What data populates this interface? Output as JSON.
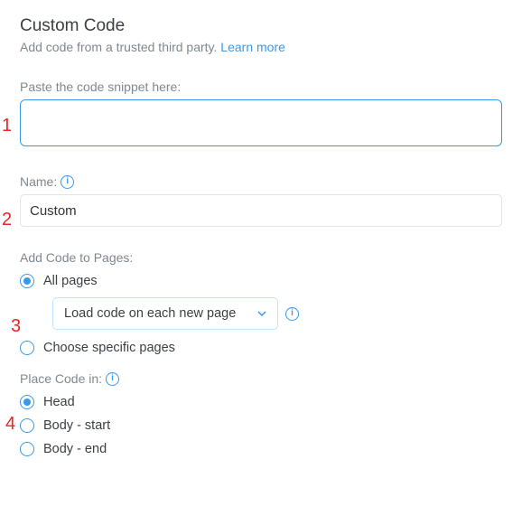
{
  "header": {
    "title": "Custom Code",
    "subtitle_prefix": "Add code from a trusted third party. ",
    "learn_more": "Learn more"
  },
  "code_field": {
    "label": "Paste the code snippet here:",
    "value": ""
  },
  "name_field": {
    "label": "Name:",
    "value": "Custom"
  },
  "pages_section": {
    "label": "Add Code to Pages:",
    "options": {
      "all": "All pages",
      "specific": "Choose specific pages"
    },
    "load_select": "Load code on each new page"
  },
  "place_section": {
    "label": "Place Code in:",
    "options": {
      "head": "Head",
      "body_start": "Body - start",
      "body_end": "Body - end"
    }
  },
  "markers": {
    "m1": "1",
    "m2": "2",
    "m3": "3",
    "m4": "4"
  }
}
